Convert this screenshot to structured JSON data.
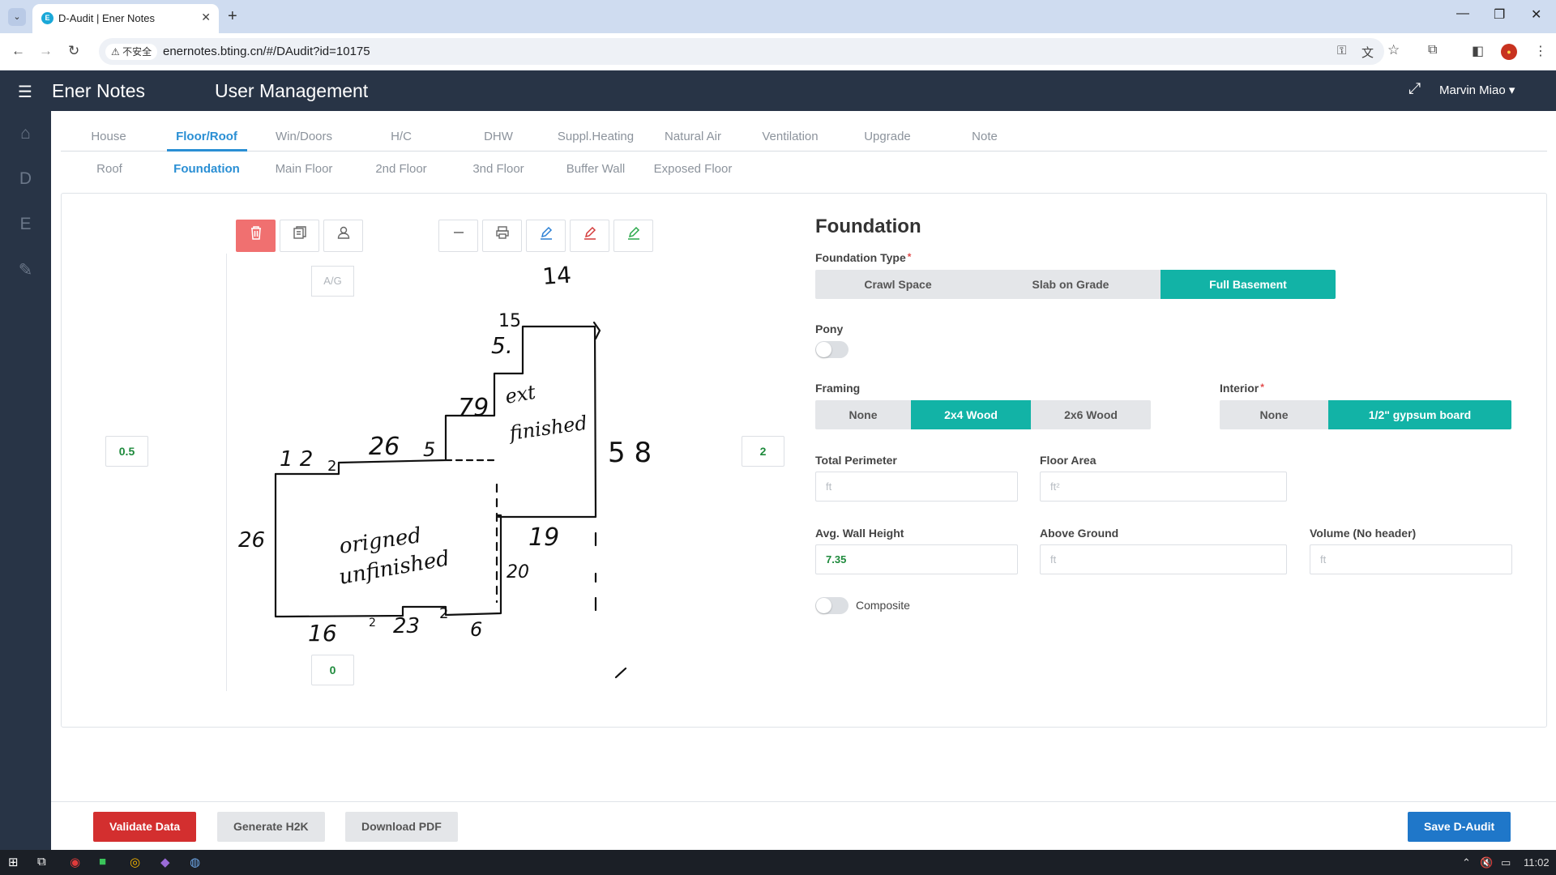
{
  "browser": {
    "tab_title": "D-Audit | Ener Notes",
    "favicon_letter": "E",
    "security_label": "⚠ 不安全",
    "url": "enernotes.bting.cn/#/DAudit?id=10175"
  },
  "header": {
    "brand": "Ener Notes",
    "section": "User Management",
    "user": "Marvin Miao ▾"
  },
  "rail": {
    "items": [
      "⌂",
      "D",
      "E",
      "✎"
    ]
  },
  "tabs": [
    "House",
    "Floor/Roof",
    "Win/Doors",
    "H/C",
    "DHW",
    "Suppl.Heating",
    "Natural Air",
    "Ventilation",
    "Upgrade",
    "Note"
  ],
  "subtabs": [
    "Roof",
    "Foundation",
    "Main Floor",
    "2nd Floor",
    "3nd Floor",
    "Buffer Wall",
    "Exposed Floor"
  ],
  "sketch": {
    "ag_label": "A/G",
    "left_value": "0.5",
    "right_value": "2",
    "bottom_value": "0",
    "tools": [
      "delete-icon",
      "copy-icon",
      "user-icon",
      "line-icon",
      "print-icon",
      "pen-blue-icon",
      "pen-red-icon",
      "pen-green-icon"
    ],
    "tool_colors": {
      "delete": "#f07070",
      "pen_blue": "#2a7fd4",
      "pen_red": "#d33a3a",
      "pen_green": "#2aa84a"
    }
  },
  "form": {
    "title": "Foundation",
    "foundation_type": {
      "label": "Foundation Type",
      "options": [
        "Crawl Space",
        "Slab on Grade",
        "Full Basement"
      ],
      "selected": "Full Basement"
    },
    "pony": {
      "label": "Pony",
      "on": false
    },
    "framing": {
      "label": "Framing",
      "options": [
        "None",
        "2x4 Wood",
        "2x6 Wood"
      ],
      "selected": "2x4 Wood"
    },
    "interior": {
      "label": "Interior",
      "options": [
        "None",
        "1/2\" gypsum board"
      ],
      "selected": "1/2\" gypsum board"
    },
    "total_perimeter": {
      "label": "Total Perimeter",
      "placeholder": "ft",
      "value": ""
    },
    "floor_area": {
      "label": "Floor Area",
      "placeholder": "ft²",
      "value": ""
    },
    "avg_wall_height": {
      "label": "Avg. Wall Height",
      "placeholder": "ft",
      "value": "7.35"
    },
    "above_ground": {
      "label": "Above Ground",
      "placeholder": "ft",
      "value": ""
    },
    "volume": {
      "label": "Volume (No header)",
      "placeholder": "ft",
      "value": ""
    },
    "composite": {
      "label": "Composite",
      "on": false
    }
  },
  "footer": {
    "validate": "Validate Data",
    "generate": "Generate H2K",
    "download": "Download PDF",
    "save": "Save D-Audit"
  },
  "taskbar": {
    "time": "11:02"
  },
  "colors": {
    "accent": "#12b3a6",
    "header_bg": "#283446",
    "active_tab": "#2a8fd4",
    "value_green": "#1e8a3c"
  }
}
